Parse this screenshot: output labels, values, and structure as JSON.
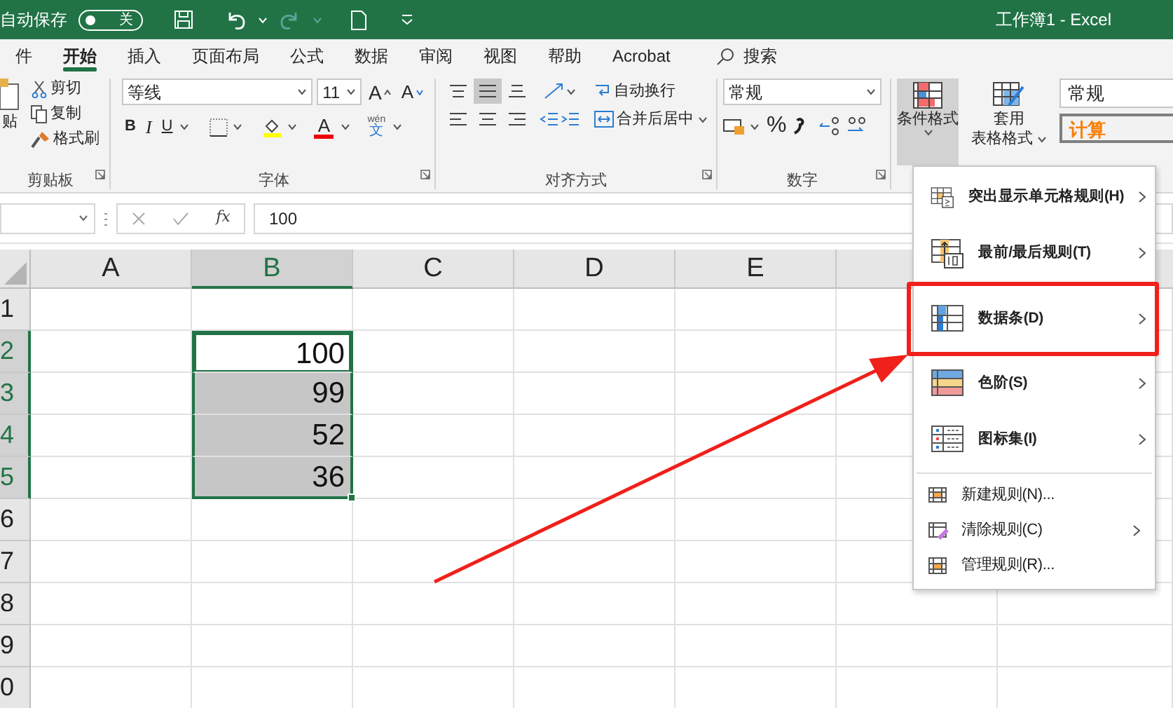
{
  "title_bar": {
    "autosave_label": "自动保存",
    "autosave": {
      "label": "关",
      "on": false
    },
    "title": "工作簿1  -  Excel"
  },
  "tabs": [
    {
      "label": "件",
      "selected": false
    },
    {
      "label": "开始",
      "selected": true
    },
    {
      "label": "插入",
      "selected": false
    },
    {
      "label": "页面布局",
      "selected": false
    },
    {
      "label": "公式",
      "selected": false
    },
    {
      "label": "数据",
      "selected": false
    },
    {
      "label": "审阅",
      "selected": false
    },
    {
      "label": "视图",
      "selected": false
    },
    {
      "label": "帮助",
      "selected": false
    },
    {
      "label": "Acrobat",
      "selected": false
    }
  ],
  "search": {
    "label": "搜索"
  },
  "ribbon": {
    "clipboard": {
      "paste": "贴",
      "cut": "剪切",
      "copy": "复制",
      "format_painter": "格式刷",
      "group_label": "剪贴板"
    },
    "font": {
      "font_name": "等线",
      "font_size": "11",
      "grow": "A",
      "shrink": "A",
      "bold": "B",
      "italic": "I",
      "underline": "U",
      "font_color": "A",
      "phonetic_top": "wén",
      "phonetic_char": "文",
      "group_label": "字体"
    },
    "alignment": {
      "middle_align_selected": true,
      "wrap_text": "自动换行",
      "merge_center": "合并后居中",
      "group_label": "对齐方式"
    },
    "number": {
      "format": "常规",
      "percent": "%",
      "group_label": "数字"
    },
    "styles": {
      "conditional_formatting": {
        "label": "条件格式",
        "selected": true
      },
      "format_as_table": [
        "套用",
        "表格格式"
      ],
      "cell_styles": [
        {
          "label": "常规",
          "kind": "normal"
        },
        {
          "label": "计算",
          "kind": "calculation"
        }
      ]
    }
  },
  "formula_bar": {
    "function_label": "fx",
    "value": "100"
  },
  "sheet": {
    "columns": [
      {
        "label": "A",
        "selected": false
      },
      {
        "label": "B",
        "selected": true
      },
      {
        "label": "C",
        "selected": false
      },
      {
        "label": "D",
        "selected": false
      },
      {
        "label": "E",
        "selected": false
      }
    ],
    "rows": [
      {
        "label": "1",
        "selected": false,
        "active": false
      },
      {
        "label": "2",
        "selected": true,
        "active": true,
        "value": "100"
      },
      {
        "label": "3",
        "selected": true,
        "active": false,
        "value": "99"
      },
      {
        "label": "4",
        "selected": true,
        "active": false,
        "value": "52"
      },
      {
        "label": "5",
        "selected": true,
        "active": false,
        "value": "36"
      },
      {
        "label": "6",
        "selected": false,
        "active": false
      },
      {
        "label": "7",
        "selected": false,
        "active": false
      },
      {
        "label": "8",
        "selected": false,
        "active": false
      },
      {
        "label": "9",
        "selected": false,
        "active": false
      },
      {
        "label": "0",
        "selected": false,
        "active": false
      }
    ]
  },
  "menu": {
    "items": [
      {
        "label": "突出显示单元格规则(H)",
        "kind": "large",
        "submenu": true,
        "outlined": false
      },
      {
        "label": "最前/最后规则(T)",
        "kind": "large",
        "submenu": true,
        "outlined": false
      },
      {
        "label": "数据条(D)",
        "kind": "large",
        "submenu": true,
        "outlined": true
      },
      {
        "label": "色阶(S)",
        "kind": "large",
        "submenu": true,
        "outlined": false
      },
      {
        "label": "图标集(I)",
        "kind": "large",
        "submenu": true,
        "outlined": false
      },
      {
        "label": "新建规则(N)...",
        "kind": "small",
        "submenu": false,
        "outlined": false
      },
      {
        "label": "清除规则(C)",
        "kind": "small",
        "submenu": true,
        "outlined": false
      },
      {
        "label": "管理规则(R)...",
        "kind": "small",
        "submenu": false,
        "outlined": false
      }
    ]
  }
}
